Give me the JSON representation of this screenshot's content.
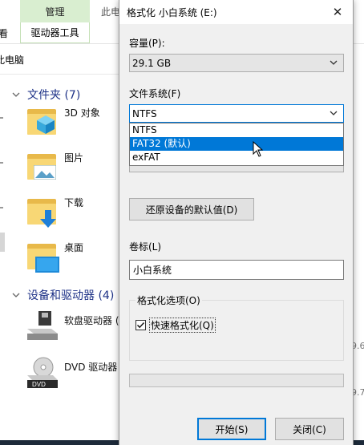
{
  "explorer": {
    "ribbon": {
      "manage_tab": "管理",
      "drive_tools": "驱动器工具",
      "left_cut_tab": "查看",
      "other_tab": "此电"
    },
    "address": "此电脑",
    "folders_group": {
      "label": "文件夹 (7)"
    },
    "items": [
      {
        "label": "3D 对象",
        "icon": "3d-objects-folder-icon"
      },
      {
        "label": "图片",
        "icon": "pictures-folder-icon"
      },
      {
        "label": "下载",
        "icon": "downloads-folder-icon"
      },
      {
        "label": "桌面",
        "icon": "desktop-folder-icon"
      }
    ],
    "devices_group": {
      "label": "设备和驱动器 (4)"
    },
    "devices": [
      {
        "label": "软盘驱动器 (",
        "icon": "floppy-drive-icon"
      },
      {
        "label": "DVD 驱动器",
        "icon": "dvd-drive-icon",
        "badge": "DVD"
      }
    ],
    "right_strip": [
      "9.6",
      "",
      "",
      "",
      "9.7"
    ]
  },
  "dialog": {
    "title": "格式化 小白系统 (E:)",
    "capacity_label": "容量(P):",
    "capacity_value": "29.1 GB",
    "filesystem_label": "文件系统(F)",
    "filesystem_value": "NTFS",
    "filesystem_options": [
      "NTFS",
      "FAT32 (默认)",
      "exFAT"
    ],
    "selected_option_index": 1,
    "restore_button": "还原设备的默认值(D)",
    "volume_label_label": "卷标(L)",
    "volume_label_value": "小白系统",
    "format_options_label": "格式化选项(O)",
    "quick_format_label": "快速格式化(Q)",
    "quick_format_checked": true,
    "progress": 0,
    "start_button": "开始(S)",
    "close_button": "关闭(C)"
  },
  "colors": {
    "accent": "#0078d7",
    "manage_tab_bg": "#d9eed0",
    "group_header": "#1e3287",
    "folder": "#f8d775"
  }
}
